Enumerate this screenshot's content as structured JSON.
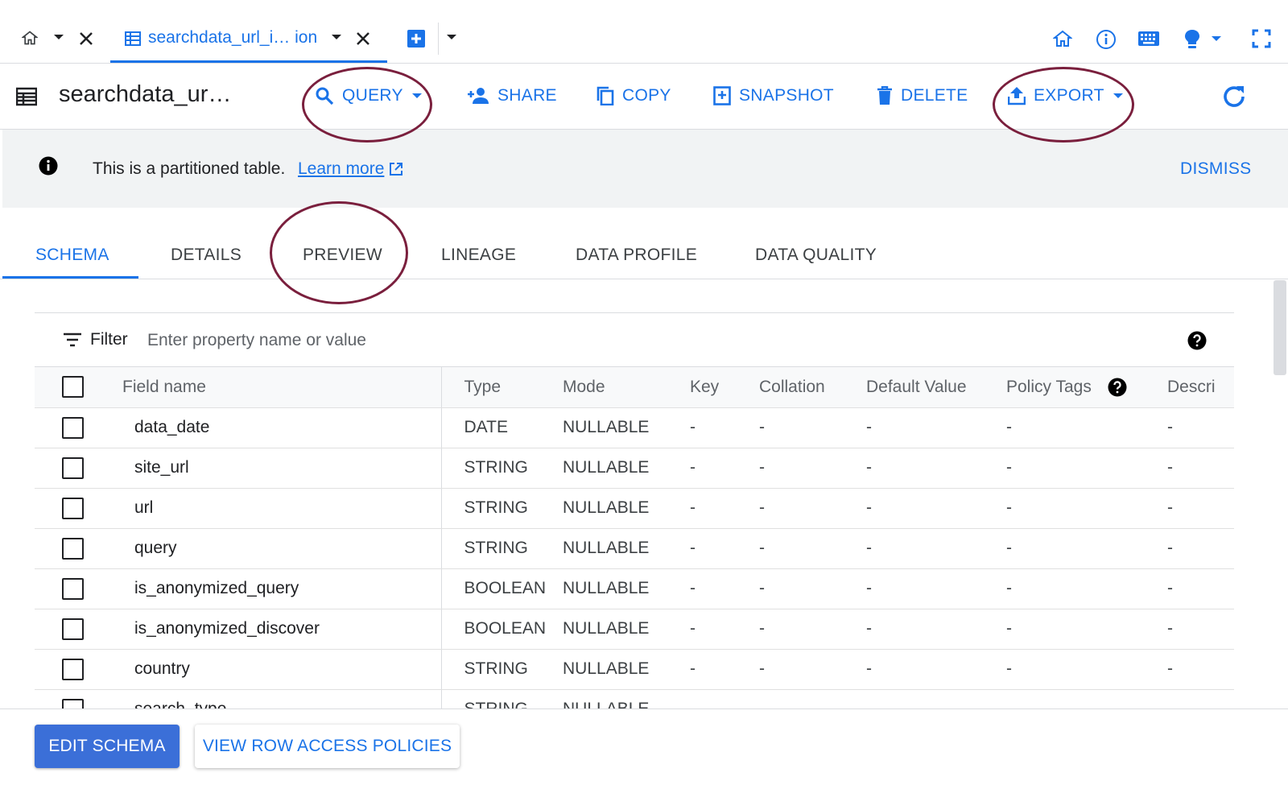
{
  "tabstrip": {
    "tab_title": "searchdata_url_i… ion",
    "icons": [
      "home-icon",
      "chevron-down-icon",
      "close-icon",
      "table-icon",
      "add-tab-icon",
      "home-outline-icon",
      "info-icon",
      "keyboard-icon",
      "lightbulb-icon",
      "fullscreen-icon"
    ]
  },
  "header": {
    "title": "searchdata_ur…",
    "actions": {
      "query": "QUERY",
      "share": "SHARE",
      "copy": "COPY",
      "snapshot": "SNAPSHOT",
      "delete": "DELETE",
      "export": "EXPORT"
    }
  },
  "banner": {
    "text": "This is a partitioned table.",
    "link": "Learn more",
    "dismiss": "DISMISS"
  },
  "tabs": [
    "SCHEMA",
    "DETAILS",
    "PREVIEW",
    "LINEAGE",
    "DATA PROFILE",
    "DATA QUALITY"
  ],
  "active_tab": "SCHEMA",
  "filter": {
    "label": "Filter",
    "placeholder": "Enter property name or value"
  },
  "table": {
    "columns": [
      "Field name",
      "Type",
      "Mode",
      "Key",
      "Collation",
      "Default Value",
      "Policy Tags",
      "Descri"
    ],
    "rows": [
      {
        "field": "data_date",
        "type": "DATE",
        "mode": "NULLABLE",
        "key": "-",
        "collation": "-",
        "default": "-",
        "policy": "-",
        "desc": "-"
      },
      {
        "field": "site_url",
        "type": "STRING",
        "mode": "NULLABLE",
        "key": "-",
        "collation": "-",
        "default": "-",
        "policy": "-",
        "desc": "-"
      },
      {
        "field": "url",
        "type": "STRING",
        "mode": "NULLABLE",
        "key": "-",
        "collation": "-",
        "default": "-",
        "policy": "-",
        "desc": "-"
      },
      {
        "field": "query",
        "type": "STRING",
        "mode": "NULLABLE",
        "key": "-",
        "collation": "-",
        "default": "-",
        "policy": "-",
        "desc": "-"
      },
      {
        "field": "is_anonymized_query",
        "type": "BOOLEAN",
        "mode": "NULLABLE",
        "key": "-",
        "collation": "-",
        "default": "-",
        "policy": "-",
        "desc": "-"
      },
      {
        "field": "is_anonymized_discover",
        "type": "BOOLEAN",
        "mode": "NULLABLE",
        "key": "-",
        "collation": "-",
        "default": "-",
        "policy": "-",
        "desc": "-"
      },
      {
        "field": "country",
        "type": "STRING",
        "mode": "NULLABLE",
        "key": "-",
        "collation": "-",
        "default": "-",
        "policy": "-",
        "desc": "-"
      },
      {
        "field": "search_type",
        "type": "STRING",
        "mode": "NULLABLE",
        "key": "",
        "collation": "",
        "default": "",
        "policy": "",
        "desc": ""
      }
    ]
  },
  "footer": {
    "edit_schema": "EDIT SCHEMA",
    "row_policies": "VIEW ROW ACCESS POLICIES"
  },
  "colors": {
    "accent": "#1a73e8",
    "primary_button": "#3b6fd8",
    "annotation": "#7a1f3d"
  }
}
